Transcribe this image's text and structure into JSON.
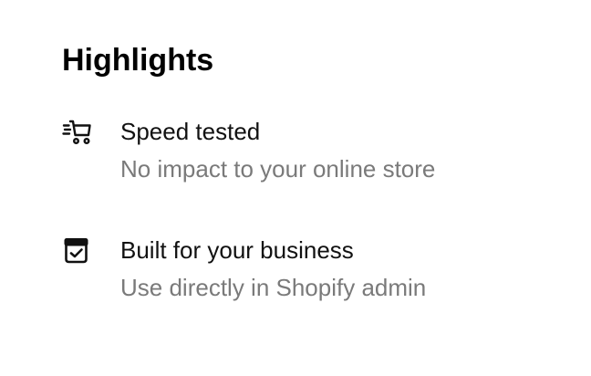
{
  "highlights": {
    "heading": "Highlights",
    "items": [
      {
        "icon": "fast-cart-icon",
        "title": "Speed tested",
        "subtitle": "No impact to your online store"
      },
      {
        "icon": "store-check-icon",
        "title": "Built for your business",
        "subtitle": "Use directly in Shopify admin"
      }
    ]
  }
}
